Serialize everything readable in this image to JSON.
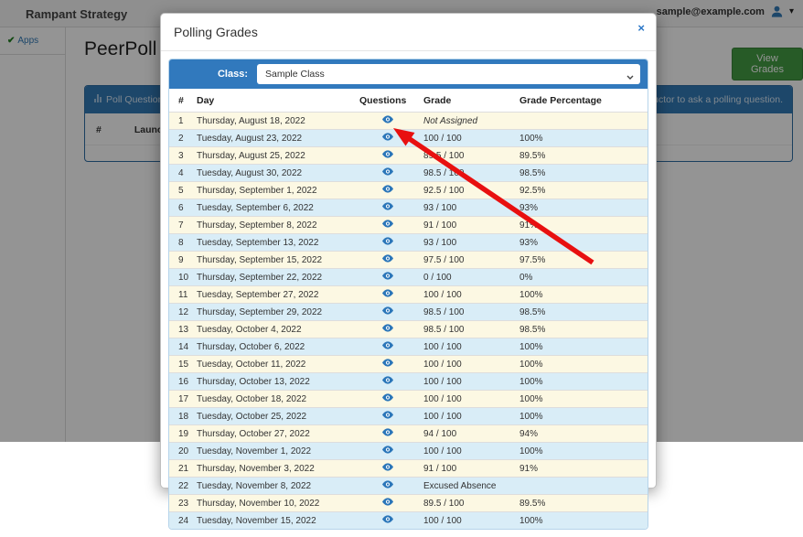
{
  "navbar": {
    "brand": "Rampant Strategy",
    "user_email": "sample@example.com"
  },
  "sidebar": {
    "apps_check": "✔",
    "apps_label": "Apps"
  },
  "page": {
    "title": "PeerPoll",
    "view_grades_label": "View Grades"
  },
  "poll_panel": {
    "heading_left": "Poll Questions A",
    "heading_right": "for your instructor to ask a polling question.",
    "col_num": "#",
    "col_launch": "Launch"
  },
  "modal": {
    "title": "Polling Grades",
    "close_glyph": "×",
    "class_label": "Class:",
    "class_selected": "Sample Class",
    "columns": {
      "num": "#",
      "day": "Day",
      "questions": "Questions",
      "grade": "Grade",
      "grade_percentage": "Grade Percentage"
    },
    "rows": [
      {
        "num": "1",
        "day": "Thursday, August 18, 2022",
        "grade": "Not Assigned",
        "italic": true,
        "pct": ""
      },
      {
        "num": "2",
        "day": "Tuesday, August 23, 2022",
        "grade": "100 / 100",
        "italic": false,
        "pct": "100%"
      },
      {
        "num": "3",
        "day": "Thursday, August 25, 2022",
        "grade": "89.5 / 100",
        "italic": false,
        "pct": "89.5%"
      },
      {
        "num": "4",
        "day": "Tuesday, August 30, 2022",
        "grade": "98.5 / 100",
        "italic": false,
        "pct": "98.5%"
      },
      {
        "num": "5",
        "day": "Thursday, September 1, 2022",
        "grade": "92.5 / 100",
        "italic": false,
        "pct": "92.5%"
      },
      {
        "num": "6",
        "day": "Tuesday, September 6, 2022",
        "grade": "93 / 100",
        "italic": false,
        "pct": "93%"
      },
      {
        "num": "7",
        "day": "Thursday, September 8, 2022",
        "grade": "91 / 100",
        "italic": false,
        "pct": "91%"
      },
      {
        "num": "8",
        "day": "Tuesday, September 13, 2022",
        "grade": "93 / 100",
        "italic": false,
        "pct": "93%"
      },
      {
        "num": "9",
        "day": "Thursday, September 15, 2022",
        "grade": "97.5 / 100",
        "italic": false,
        "pct": "97.5%"
      },
      {
        "num": "10",
        "day": "Thursday, September 22, 2022",
        "grade": "0 / 100",
        "italic": false,
        "pct": "0%"
      },
      {
        "num": "11",
        "day": "Tuesday, September 27, 2022",
        "grade": "100 / 100",
        "italic": false,
        "pct": "100%"
      },
      {
        "num": "12",
        "day": "Thursday, September 29, 2022",
        "grade": "98.5 / 100",
        "italic": false,
        "pct": "98.5%"
      },
      {
        "num": "13",
        "day": "Tuesday, October 4, 2022",
        "grade": "98.5 / 100",
        "italic": false,
        "pct": "98.5%"
      },
      {
        "num": "14",
        "day": "Thursday, October 6, 2022",
        "grade": "100 / 100",
        "italic": false,
        "pct": "100%"
      },
      {
        "num": "15",
        "day": "Tuesday, October 11, 2022",
        "grade": "100 / 100",
        "italic": false,
        "pct": "100%"
      },
      {
        "num": "16",
        "day": "Thursday, October 13, 2022",
        "grade": "100 / 100",
        "italic": false,
        "pct": "100%"
      },
      {
        "num": "17",
        "day": "Tuesday, October 18, 2022",
        "grade": "100 / 100",
        "italic": false,
        "pct": "100%"
      },
      {
        "num": "18",
        "day": "Tuesday, October 25, 2022",
        "grade": "100 / 100",
        "italic": false,
        "pct": "100%"
      },
      {
        "num": "19",
        "day": "Thursday, October 27, 2022",
        "grade": "94 / 100",
        "italic": false,
        "pct": "94%"
      },
      {
        "num": "20",
        "day": "Tuesday, November 1, 2022",
        "grade": "100 / 100",
        "italic": false,
        "pct": "100%"
      },
      {
        "num": "21",
        "day": "Thursday, November 3, 2022",
        "grade": "91 / 100",
        "italic": false,
        "pct": "91%"
      },
      {
        "num": "22",
        "day": "Tuesday, November 8, 2022",
        "grade": "Excused Absence",
        "italic": false,
        "pct": ""
      },
      {
        "num": "23",
        "day": "Thursday, November 10, 2022",
        "grade": "89.5 / 100",
        "italic": false,
        "pct": "89.5%"
      },
      {
        "num": "24",
        "day": "Tuesday, November 15, 2022",
        "grade": "100 / 100",
        "italic": false,
        "pct": "100%"
      }
    ]
  },
  "colors": {
    "primary_blue": "#337ab7",
    "class_bar_blue": "#3179bd",
    "success_green": "#449d44",
    "row_odd_cream": "#fcf8e3",
    "row_even_blue": "#d9edf7",
    "arrow_red": "#e81010",
    "eye_blue": "#2b76b9"
  }
}
